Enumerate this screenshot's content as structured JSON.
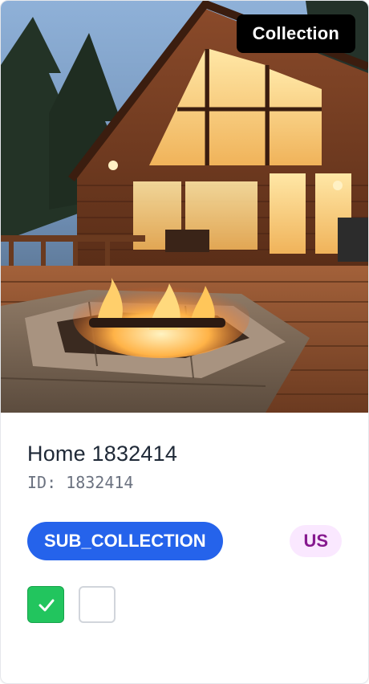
{
  "card": {
    "badge": "Collection",
    "image_alt": "log cabin with fire pit at dusk",
    "title": "Home 1832414",
    "id_line": "ID: 1832414",
    "tag": "SUB_COLLECTION",
    "country": "US",
    "checkbox_1_checked": true,
    "checkbox_2_checked": false
  },
  "colors": {
    "badge_bg": "#000000",
    "tag_bg": "#2563eb",
    "country_bg": "#fae8ff",
    "country_text": "#86198f",
    "check_on": "#22c55e"
  },
  "icons": {
    "checkmark": "check-icon"
  }
}
